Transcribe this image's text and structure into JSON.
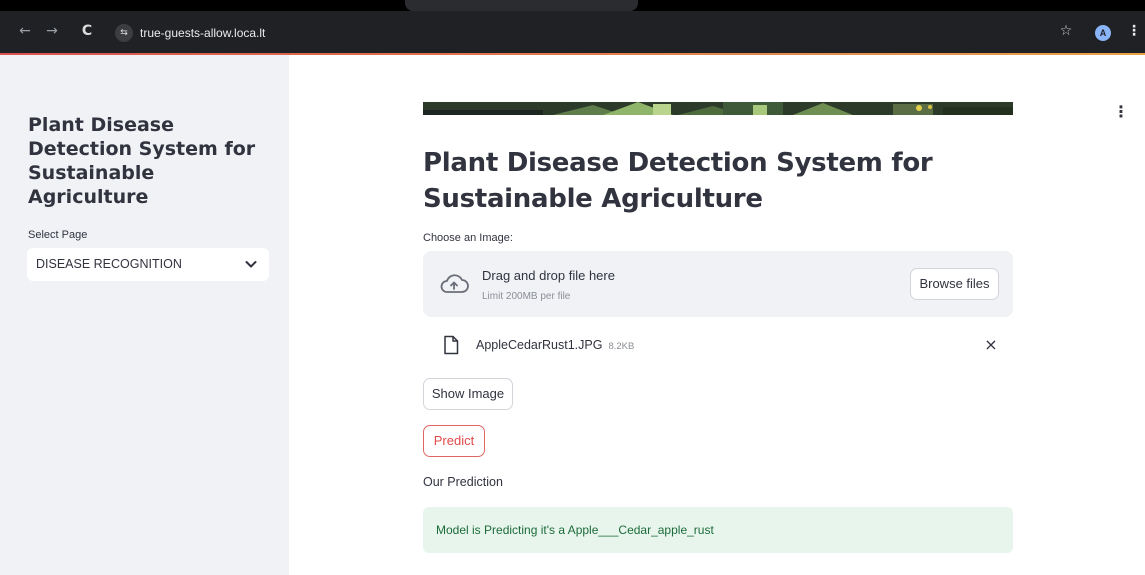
{
  "browser": {
    "url": "true-guests-allow.loca.lt",
    "profile_initial": "A",
    "back_glyph": "←",
    "forward_glyph": "→",
    "reload_glyph": "C",
    "site_info_glyph": "⇆",
    "star_glyph": "☆",
    "menu_glyph": "⋮"
  },
  "sidebar": {
    "title": "Plant Disease Detection System for Sustainable Agriculture",
    "select_label": "Select Page",
    "select_value": "DISEASE RECOGNITION"
  },
  "main": {
    "menu_glyph": "⋮",
    "title": "Plant Disease Detection System for Sustainable Agriculture",
    "uploader": {
      "label": "Choose an Image:",
      "drag_text": "Drag and drop file here",
      "limit_text": "Limit 200MB per file",
      "browse_label": "Browse files",
      "file_name": "AppleCedarRust1.JPG",
      "file_size": "8.2KB",
      "remove_glyph": "×"
    },
    "show_image_label": "Show Image",
    "predict_label": "Predict",
    "prediction_heading": "Our Prediction",
    "prediction_result": "Model is Predicting it's a Apple___Cedar_apple_rust"
  },
  "colors": {
    "sidebar_bg": "#f0f2f6",
    "text": "#31333f",
    "predict_red": "#e24a4a",
    "success_bg": "#e8f5ec",
    "success_text": "#1c6b3a"
  }
}
